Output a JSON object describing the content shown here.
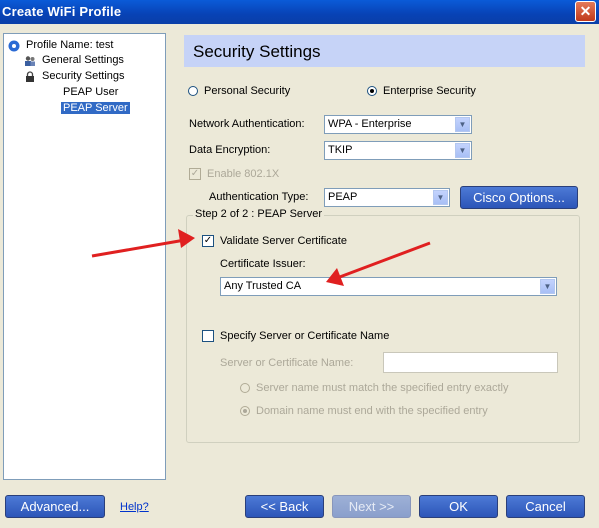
{
  "window": {
    "title": "Create WiFi Profile"
  },
  "tree": {
    "items": [
      {
        "label": "Profile Name: test",
        "icon": "wifi-icon"
      },
      {
        "label": "General Settings",
        "icon": "users-icon"
      },
      {
        "label": "Security Settings",
        "icon": "lock-icon"
      },
      {
        "label": "PEAP User",
        "icon": ""
      },
      {
        "label": "PEAP Server",
        "icon": "",
        "selected": true
      }
    ]
  },
  "header": {
    "title": "Security Settings"
  },
  "security_mode": {
    "personal_label": "Personal Security",
    "enterprise_label": "Enterprise Security",
    "selected": "enterprise"
  },
  "network_auth": {
    "label": "Network Authentication:",
    "value": "WPA - Enterprise"
  },
  "data_encryption": {
    "label": "Data Encryption:",
    "value": "TKIP"
  },
  "enable_8021x": {
    "label": "Enable 802.1X",
    "checked": true,
    "disabled": true
  },
  "auth_type": {
    "label": "Authentication Type:",
    "value": "PEAP"
  },
  "cisco_button": {
    "label": "Cisco Options..."
  },
  "step_group": {
    "title": "Step 2 of 2 : PEAP Server",
    "validate_cert": {
      "label": "Validate Server Certificate",
      "checked": true
    },
    "cert_issuer": {
      "label": "Certificate Issuer:",
      "value": "Any Trusted CA"
    },
    "specify_server": {
      "label": "Specify Server or Certificate Name",
      "checked": false
    },
    "server_name": {
      "label": "Server or Certificate Name:",
      "value": ""
    },
    "match_exact": {
      "label": "Server name must match the specified entry exactly",
      "selected": false
    },
    "domain_end": {
      "label": "Domain name must end with the specified entry",
      "selected": true
    }
  },
  "footer": {
    "advanced": "Advanced...",
    "help": "Help?",
    "back": "<< Back",
    "next": "Next >>",
    "ok": "OK",
    "cancel": "Cancel"
  },
  "colors": {
    "annotation_arrow": "#e02020",
    "button_blue": "#2c55b8",
    "selection": "#316ac5"
  }
}
